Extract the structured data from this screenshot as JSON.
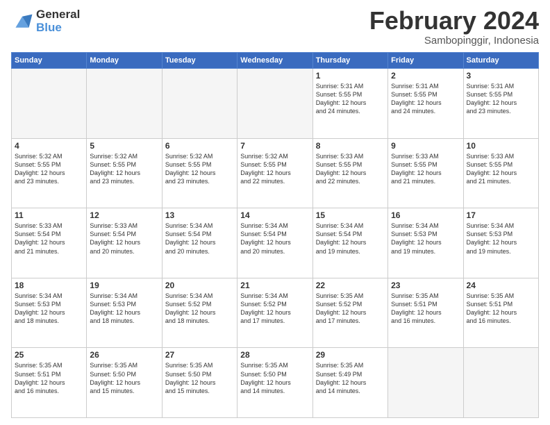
{
  "logo": {
    "line1": "General",
    "line2": "Blue"
  },
  "title": "February 2024",
  "location": "Sambopinggir, Indonesia",
  "weekdays": [
    "Sunday",
    "Monday",
    "Tuesday",
    "Wednesday",
    "Thursday",
    "Friday",
    "Saturday"
  ],
  "weeks": [
    [
      {
        "day": "",
        "info": ""
      },
      {
        "day": "",
        "info": ""
      },
      {
        "day": "",
        "info": ""
      },
      {
        "day": "",
        "info": ""
      },
      {
        "day": "1",
        "info": "Sunrise: 5:31 AM\nSunset: 5:55 PM\nDaylight: 12 hours\nand 24 minutes."
      },
      {
        "day": "2",
        "info": "Sunrise: 5:31 AM\nSunset: 5:55 PM\nDaylight: 12 hours\nand 24 minutes."
      },
      {
        "day": "3",
        "info": "Sunrise: 5:31 AM\nSunset: 5:55 PM\nDaylight: 12 hours\nand 23 minutes."
      }
    ],
    [
      {
        "day": "4",
        "info": "Sunrise: 5:32 AM\nSunset: 5:55 PM\nDaylight: 12 hours\nand 23 minutes."
      },
      {
        "day": "5",
        "info": "Sunrise: 5:32 AM\nSunset: 5:55 PM\nDaylight: 12 hours\nand 23 minutes."
      },
      {
        "day": "6",
        "info": "Sunrise: 5:32 AM\nSunset: 5:55 PM\nDaylight: 12 hours\nand 23 minutes."
      },
      {
        "day": "7",
        "info": "Sunrise: 5:32 AM\nSunset: 5:55 PM\nDaylight: 12 hours\nand 22 minutes."
      },
      {
        "day": "8",
        "info": "Sunrise: 5:33 AM\nSunset: 5:55 PM\nDaylight: 12 hours\nand 22 minutes."
      },
      {
        "day": "9",
        "info": "Sunrise: 5:33 AM\nSunset: 5:55 PM\nDaylight: 12 hours\nand 21 minutes."
      },
      {
        "day": "10",
        "info": "Sunrise: 5:33 AM\nSunset: 5:55 PM\nDaylight: 12 hours\nand 21 minutes."
      }
    ],
    [
      {
        "day": "11",
        "info": "Sunrise: 5:33 AM\nSunset: 5:54 PM\nDaylight: 12 hours\nand 21 minutes."
      },
      {
        "day": "12",
        "info": "Sunrise: 5:33 AM\nSunset: 5:54 PM\nDaylight: 12 hours\nand 20 minutes."
      },
      {
        "day": "13",
        "info": "Sunrise: 5:34 AM\nSunset: 5:54 PM\nDaylight: 12 hours\nand 20 minutes."
      },
      {
        "day": "14",
        "info": "Sunrise: 5:34 AM\nSunset: 5:54 PM\nDaylight: 12 hours\nand 20 minutes."
      },
      {
        "day": "15",
        "info": "Sunrise: 5:34 AM\nSunset: 5:54 PM\nDaylight: 12 hours\nand 19 minutes."
      },
      {
        "day": "16",
        "info": "Sunrise: 5:34 AM\nSunset: 5:53 PM\nDaylight: 12 hours\nand 19 minutes."
      },
      {
        "day": "17",
        "info": "Sunrise: 5:34 AM\nSunset: 5:53 PM\nDaylight: 12 hours\nand 19 minutes."
      }
    ],
    [
      {
        "day": "18",
        "info": "Sunrise: 5:34 AM\nSunset: 5:53 PM\nDaylight: 12 hours\nand 18 minutes."
      },
      {
        "day": "19",
        "info": "Sunrise: 5:34 AM\nSunset: 5:53 PM\nDaylight: 12 hours\nand 18 minutes."
      },
      {
        "day": "20",
        "info": "Sunrise: 5:34 AM\nSunset: 5:52 PM\nDaylight: 12 hours\nand 18 minutes."
      },
      {
        "day": "21",
        "info": "Sunrise: 5:34 AM\nSunset: 5:52 PM\nDaylight: 12 hours\nand 17 minutes."
      },
      {
        "day": "22",
        "info": "Sunrise: 5:35 AM\nSunset: 5:52 PM\nDaylight: 12 hours\nand 17 minutes."
      },
      {
        "day": "23",
        "info": "Sunrise: 5:35 AM\nSunset: 5:51 PM\nDaylight: 12 hours\nand 16 minutes."
      },
      {
        "day": "24",
        "info": "Sunrise: 5:35 AM\nSunset: 5:51 PM\nDaylight: 12 hours\nand 16 minutes."
      }
    ],
    [
      {
        "day": "25",
        "info": "Sunrise: 5:35 AM\nSunset: 5:51 PM\nDaylight: 12 hours\nand 16 minutes."
      },
      {
        "day": "26",
        "info": "Sunrise: 5:35 AM\nSunset: 5:50 PM\nDaylight: 12 hours\nand 15 minutes."
      },
      {
        "day": "27",
        "info": "Sunrise: 5:35 AM\nSunset: 5:50 PM\nDaylight: 12 hours\nand 15 minutes."
      },
      {
        "day": "28",
        "info": "Sunrise: 5:35 AM\nSunset: 5:50 PM\nDaylight: 12 hours\nand 14 minutes."
      },
      {
        "day": "29",
        "info": "Sunrise: 5:35 AM\nSunset: 5:49 PM\nDaylight: 12 hours\nand 14 minutes."
      },
      {
        "day": "",
        "info": ""
      },
      {
        "day": "",
        "info": ""
      }
    ]
  ]
}
